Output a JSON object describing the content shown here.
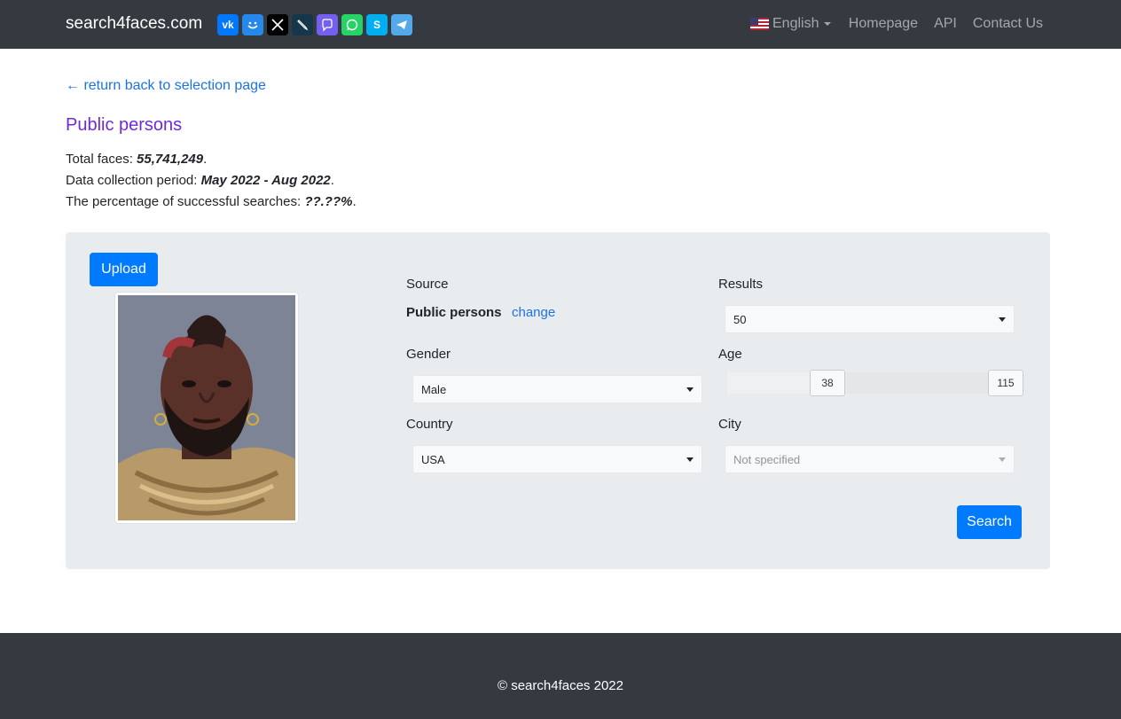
{
  "nav": {
    "brand": "search4faces.com",
    "social": [
      {
        "name": "vk-icon",
        "glyph": "vk",
        "color": "#0077ff"
      },
      {
        "name": "mymail-icon",
        "glyph": "◡",
        "color": "#2688eb"
      },
      {
        "name": "x-icon",
        "glyph": "X",
        "color": "#000000"
      },
      {
        "name": "livejournal-icon",
        "glyph": "✎",
        "color": "#15374c"
      },
      {
        "name": "viber-icon",
        "glyph": "✆",
        "color": "#7360f2"
      },
      {
        "name": "whatsapp-icon",
        "glyph": "✆",
        "color": "#25d366"
      },
      {
        "name": "skype-icon",
        "glyph": "S",
        "color": "#00aff0"
      },
      {
        "name": "telegram-icon",
        "glyph": "➤",
        "color": "#54a9eb"
      }
    ],
    "language": "English",
    "links": [
      "Homepage",
      "API",
      "Contact Us"
    ]
  },
  "back_link": "← return back to selection page",
  "page_title": "Public persons",
  "stats": {
    "total_faces_label": "Total faces: ",
    "total_faces": "55,741,249",
    "period_label": "Data collection period: ",
    "period": "May 2022 - Aug 2022",
    "success_label": "The percentage of successful searches: ",
    "success": "??.??%",
    "dot": "."
  },
  "form": {
    "upload_label": "Upload",
    "source_label": "Source",
    "source_value": "Public persons",
    "change_label": "change",
    "results_label": "Results",
    "results_value": "50",
    "gender_label": "Gender",
    "gender_value": "Male",
    "age_label": "Age",
    "age_min": "38",
    "age_max": "115",
    "country_label": "Country",
    "country_value": "USA",
    "city_label": "City",
    "city_value": "Not specified",
    "search_label": "Search"
  },
  "footer": {
    "copyright": "© search4faces 2022"
  }
}
